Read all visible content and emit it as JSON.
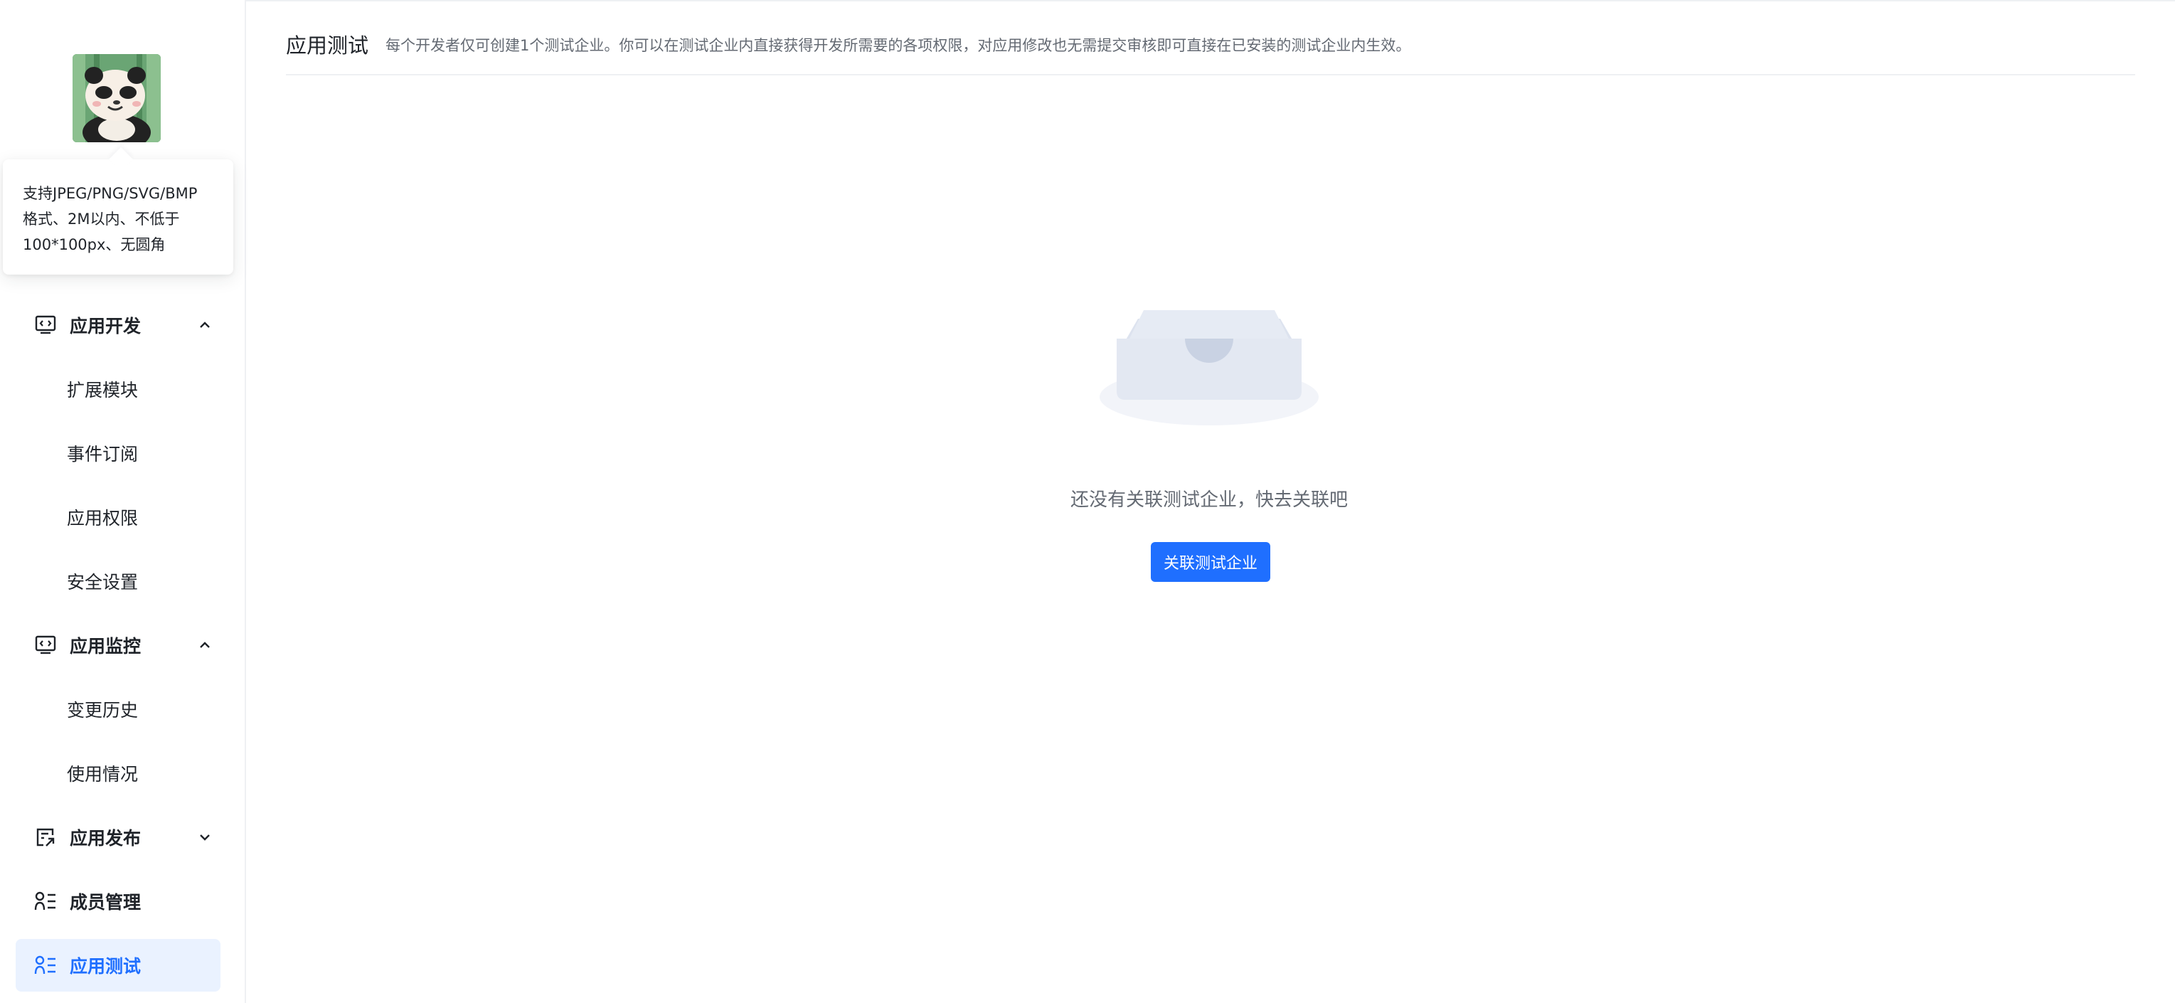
{
  "colors": {
    "accent": "#1f6fff",
    "active_bg": "#eaf2ff",
    "text": "#1f2329",
    "muted": "#646a73"
  },
  "sidebar": {
    "avatar_icon": "panda-avatar",
    "tooltip": {
      "line1": "支持JPEG/PNG/SVG/BMP",
      "line2": "格式、2M以内、不低于",
      "line3": "100*100px、无圆角"
    },
    "groups": {
      "app_dev": {
        "label": "应用开发",
        "icon": "code-window-icon",
        "expanded": true,
        "items": {
          "ext": "扩展模块",
          "events": "事件订阅",
          "perm": "应用权限",
          "security": "安全设置"
        }
      },
      "monitor": {
        "label": "应用监控",
        "icon": "code-window-icon",
        "expanded": true,
        "items": {
          "history": "变更历史",
          "usage": "使用情况"
        }
      },
      "publish": {
        "label": "应用发布",
        "icon": "publish-icon",
        "expanded": false
      },
      "members": {
        "label": "成员管理",
        "icon": "member-list-icon"
      },
      "testing": {
        "label": "应用测试",
        "icon": "member-list-icon",
        "active": true
      }
    }
  },
  "main": {
    "title": "应用测试",
    "description": "每个开发者仅可创建1个测试企业。你可以在测试企业内直接获得开发所需要的各项权限，对应用修改也无需提交审核即可直接在已安装的测试企业内生效。",
    "empty": {
      "icon": "empty-inbox-icon",
      "text": "还没有关联测试企业，快去关联吧",
      "button": "关联测试企业"
    }
  }
}
